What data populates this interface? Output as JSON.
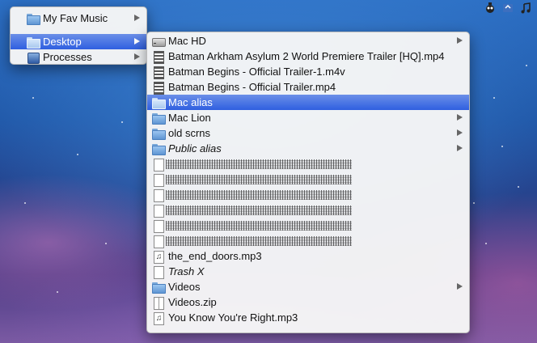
{
  "menubar": {
    "icons": [
      "bug-icon",
      "sync-icon",
      "music-note-icon"
    ]
  },
  "root_menu": {
    "items": [
      {
        "label": "My Fav Music",
        "icon": "folder-icon",
        "has_submenu": true
      },
      {
        "label": "Desktop",
        "icon": "folder-icon",
        "has_submenu": true,
        "selected": true
      },
      {
        "label": "Processes",
        "icon": "app-icon",
        "has_submenu": true
      }
    ]
  },
  "desktop_menu": {
    "items": [
      {
        "label": "Mac HD",
        "icon": "drive-icon",
        "has_submenu": true
      },
      {
        "label": "Batman Arkham Asylum 2 World Premiere Trailer [HQ].mp4",
        "icon": "movie-icon",
        "has_submenu": false
      },
      {
        "label": "Batman Begins - Official Trailer-1.m4v",
        "icon": "movie-icon",
        "has_submenu": false
      },
      {
        "label": "Batman Begins - Official Trailer.mp4",
        "icon": "movie-icon",
        "has_submenu": false
      },
      {
        "label": "Mac alias",
        "icon": "folder-icon",
        "has_submenu": false,
        "selected": true
      },
      {
        "label": "Mac Lion",
        "icon": "folder-icon",
        "has_submenu": true
      },
      {
        "label": "old scrns",
        "icon": "folder-icon",
        "has_submenu": true
      },
      {
        "label": "Public alias",
        "icon": "folder-icon",
        "has_submenu": true,
        "italic": true
      },
      {
        "redacted": true,
        "icon": "file-icon"
      },
      {
        "redacted": true,
        "icon": "file-icon"
      },
      {
        "redacted": true,
        "icon": "file-icon"
      },
      {
        "redacted": true,
        "icon": "file-icon"
      },
      {
        "redacted": true,
        "icon": "file-icon"
      },
      {
        "redacted": true,
        "icon": "file-icon"
      },
      {
        "label": "the_end_doors.mp3",
        "icon": "audio-icon",
        "has_submenu": false
      },
      {
        "label": "Trash X",
        "icon": "file-icon",
        "has_submenu": false,
        "italic": true
      },
      {
        "label": "Videos",
        "icon": "folder-icon",
        "has_submenu": true
      },
      {
        "label": "Videos.zip",
        "icon": "zip-icon",
        "has_submenu": false
      },
      {
        "label": "You Know You're Right.mp3",
        "icon": "audio-icon",
        "has_submenu": false
      }
    ]
  }
}
